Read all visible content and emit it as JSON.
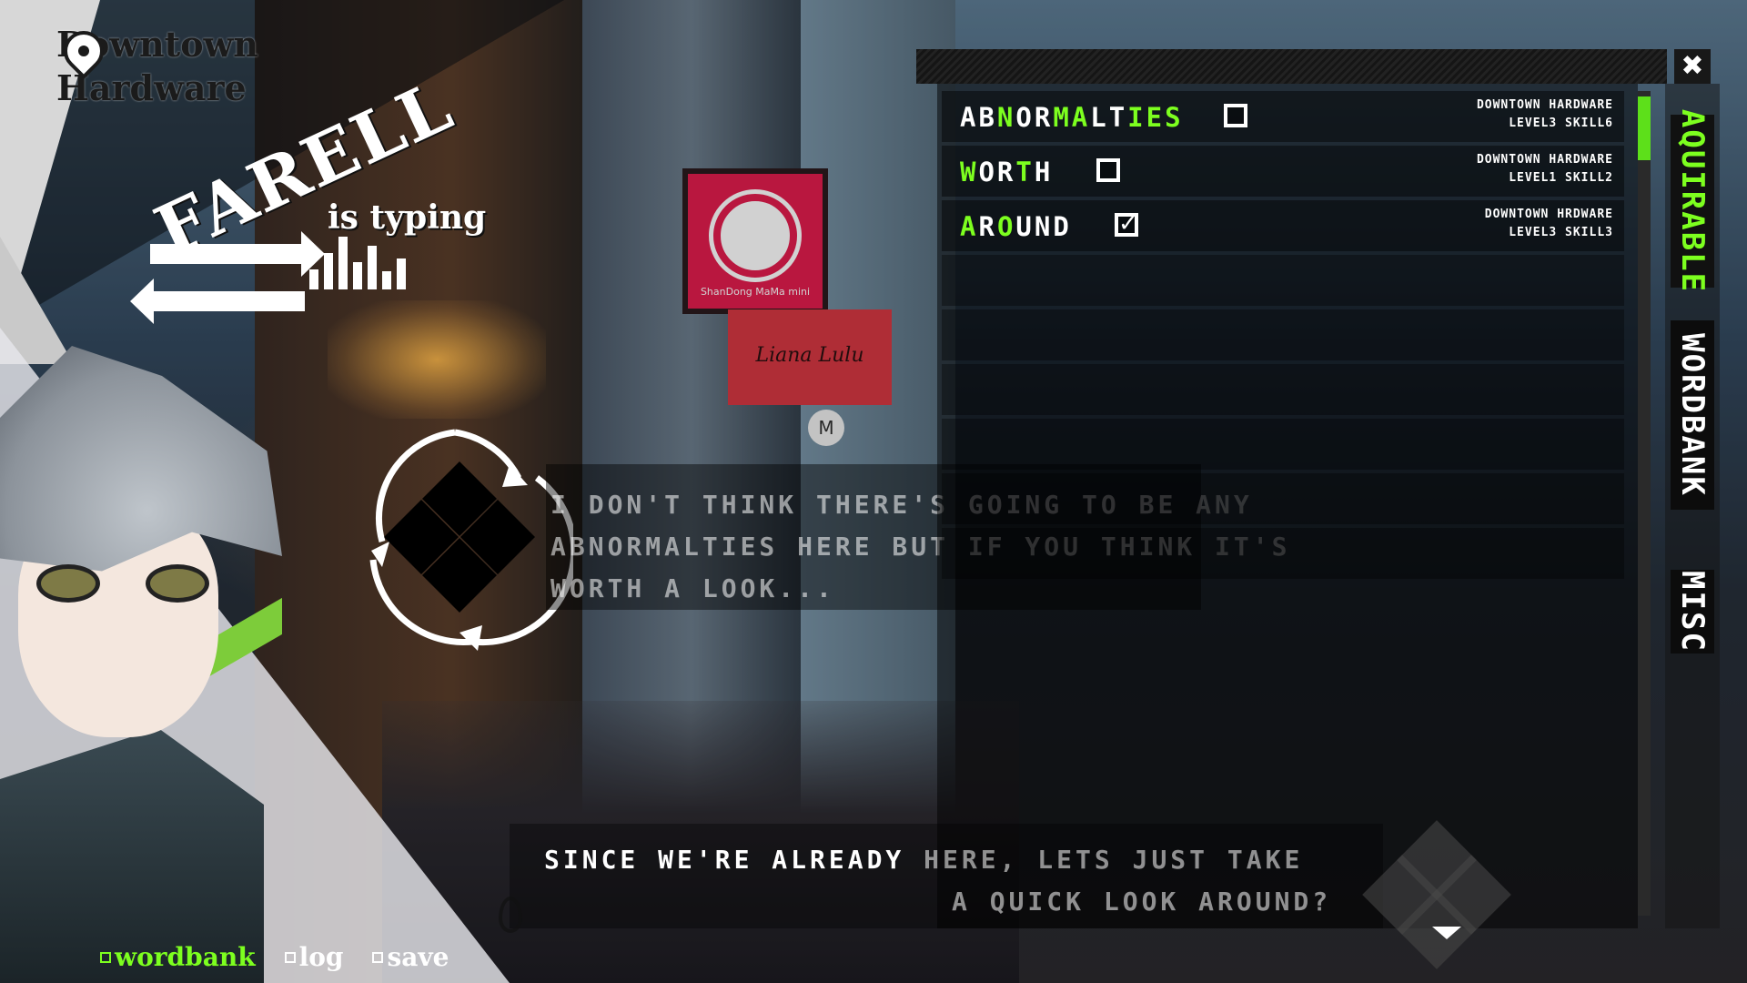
{
  "location": {
    "line1": "Downtown",
    "line2": "Hardware"
  },
  "signs": {
    "red_sign": "ShanDong MaMa mini",
    "lulu_sign": "Liana Lulu",
    "m_sign": "M"
  },
  "speaker": {
    "name": "FARELL",
    "status": "is typing"
  },
  "center_dialog": {
    "line1": "I don't think there's going to be any",
    "line2": "abnormalties here but if you think it's",
    "line3": "worth a look..."
  },
  "bottom_dialog": {
    "line1_bright": "Since we're already ",
    "line1_faded": "here, lets just take",
    "line2": "a quick look around?"
  },
  "menu": {
    "items": [
      {
        "label": "wordbank",
        "active": true
      },
      {
        "label": "log",
        "active": false
      },
      {
        "label": "save",
        "active": false
      }
    ]
  },
  "wordbank_panel": {
    "close_label": "✖",
    "words": [
      {
        "parts": [
          [
            "AB",
            false
          ],
          [
            "N",
            true
          ],
          [
            "OR",
            false
          ],
          [
            "MA",
            true
          ],
          [
            "LT",
            false
          ],
          [
            "IES",
            true
          ]
        ],
        "checked": false,
        "source": "Downtown Hardware",
        "level": "Level3",
        "skill": "Skill6"
      },
      {
        "parts": [
          [
            "W",
            true
          ],
          [
            "OR",
            false
          ],
          [
            "T",
            true
          ],
          [
            "H",
            false
          ]
        ],
        "checked": false,
        "source": "Downtown Hardware",
        "level": "Level1",
        "skill": "Skill2"
      },
      {
        "parts": [
          [
            "A",
            true
          ],
          [
            "R",
            false
          ],
          [
            "O",
            true
          ],
          [
            "UND",
            false
          ]
        ],
        "checked": true,
        "source": "Downtown Hrdware",
        "level": "Level3",
        "skill": "Skill3"
      }
    ],
    "check_mark": "✓"
  },
  "side_tabs": {
    "tab1": "Aquirable",
    "tab2": "Wordbank",
    "tab3": "Misc"
  },
  "colors": {
    "accent_green": "#7dff1f",
    "scroll_green": "#5de01a",
    "sign_red": "#e21d4d"
  },
  "icons": [
    "location-pin-icon",
    "arrows-exchange-icon",
    "loading-cycle-icon",
    "close-icon",
    "checkbox-icon",
    "drop-icon",
    "down-triangle-icon"
  ]
}
